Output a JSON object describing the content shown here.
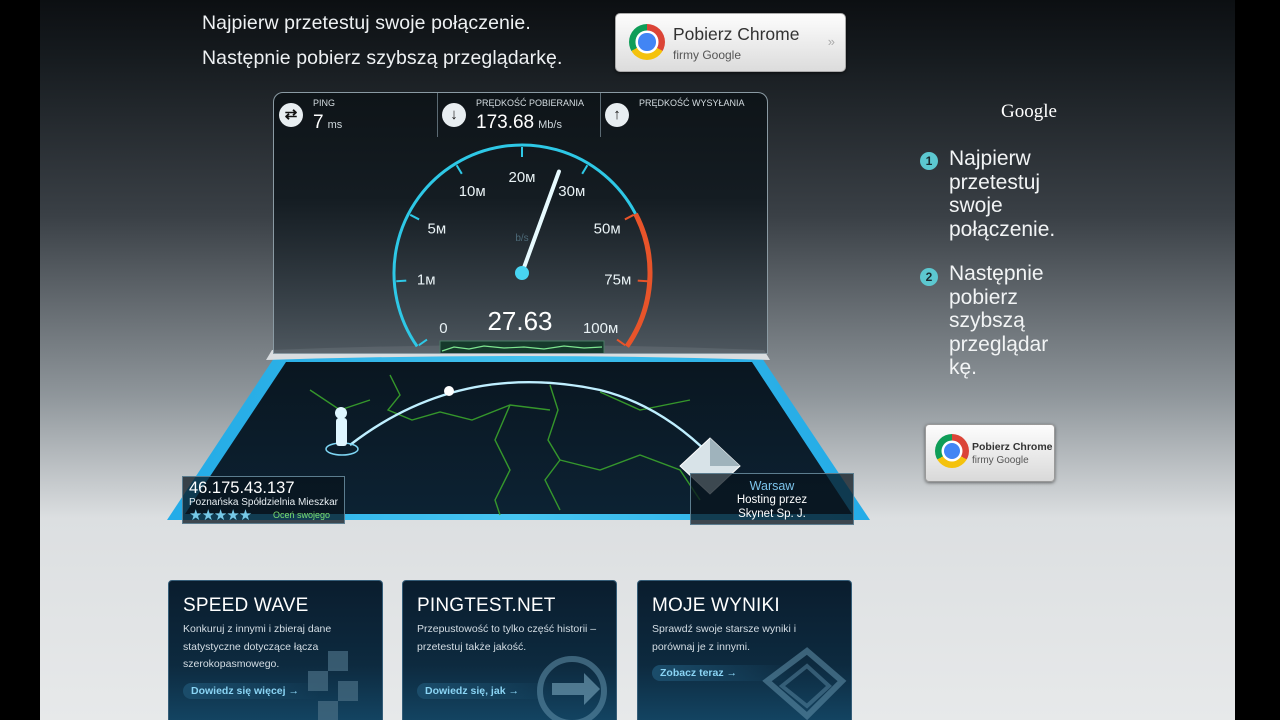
{
  "header": {
    "line1": "Najpierw przetestuj swoje połączenie.",
    "line2": "Następnie pobierz szybszą przeglądarkę.",
    "chrome_button": {
      "title": "Pobierz Chrome",
      "subtitle": "firmy Google",
      "arrow": "»"
    }
  },
  "sidebar": {
    "brand": "Google",
    "steps": [
      {
        "num": "1",
        "lines": [
          "Najpierw",
          "przetestuj",
          "swoje",
          "połączenie."
        ]
      },
      {
        "num": "2",
        "lines": [
          "Następnie",
          "pobierz",
          "szybszą",
          "przeglądar",
          "kę."
        ]
      }
    ],
    "chrome_button": {
      "title": "Pobierz Chrome",
      "subtitle": "firmy Google"
    }
  },
  "stats": {
    "ping": {
      "label": "PING",
      "value": "7",
      "unit": "ms",
      "icon": "ping-icon"
    },
    "download": {
      "label": "PRĘDKOŚĆ POBIERANIA",
      "value": "173.68",
      "unit": "Mb/s",
      "icon": "download-arrow-icon"
    },
    "upload": {
      "label": "PRĘDKOŚĆ WYSYŁANIA",
      "value": "",
      "unit": "",
      "icon": "upload-arrow-icon"
    }
  },
  "gauge": {
    "ticks": [
      "0",
      "1м",
      "5м",
      "10м",
      "20м",
      "30м",
      "50м",
      "75м",
      "100м"
    ],
    "unit_label": "b/s",
    "reading": "27.63",
    "needle_fraction": 0.58,
    "accent": "#2ec8e6",
    "danger": "#e8542a"
  },
  "client": {
    "ip": "46.175.43.137",
    "isp": "Poznańska Spółdzielnia Mieszkar",
    "stars": "★★★★★",
    "rate_label": "Oceń swojego"
  },
  "server": {
    "city": "Warsaw",
    "host_line1": "Hosting przez",
    "host_line2": "Skynet Sp. J."
  },
  "panels": [
    {
      "title": "SPEED WAVE",
      "text": "Konkuruj z innymi i zbieraj dane statystyczne dotyczące łącza szerokopasmowego.",
      "cta": "Dowiedz się więcej →"
    },
    {
      "title": "PINGTEST.NET",
      "text": "Przepustowość to tylko część historii – przetestuj także jakość.",
      "cta": "Dowiedz się, jak →"
    },
    {
      "title": "MOJE WYNIKI",
      "text": "Sprawdź swoje starsze wyniki i porównaj je z innymi.",
      "cta": "Zobacz teraz →"
    }
  ]
}
